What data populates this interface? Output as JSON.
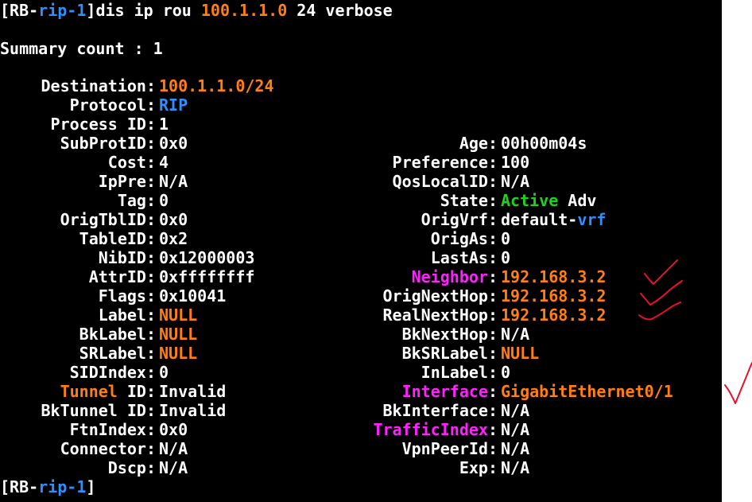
{
  "command": {
    "prompt_open": "[RB-",
    "prompt_name": "rip-1",
    "prompt_close": "]",
    "cmd": "dis ip rou ",
    "ip": "100.1.1.0",
    "rest": " 24 verbose"
  },
  "summary": {
    "label": "Summary count : ",
    "value": "1"
  },
  "destination": {
    "label": "Destination:",
    "value": "100.1.1.0/24"
  },
  "protocol": {
    "label": "Protocol:",
    "value": "RIP"
  },
  "process_id": {
    "label": "Process ID:",
    "value": "1"
  },
  "left_fields": [
    {
      "label": "SubProtID:",
      "value": "0x0"
    },
    {
      "label": "Cost:",
      "value": "4"
    },
    {
      "label": "IpPre:",
      "value": "N/A"
    },
    {
      "label": "Tag:",
      "value": "0"
    },
    {
      "label": "OrigTblID:",
      "value": "0x0"
    },
    {
      "label": "TableID:",
      "value": "0x2"
    },
    {
      "label": "NibID:",
      "value": "0x12000003"
    },
    {
      "label": "AttrID:",
      "value": "0xffffffff"
    },
    {
      "label": "Flags:",
      "value": "0x10041"
    },
    {
      "label": "Label:",
      "value": "NULL"
    },
    {
      "label": "BkLabel:",
      "value": "NULL"
    },
    {
      "label": "SRLabel:",
      "value": "NULL"
    },
    {
      "label": "SIDIndex:",
      "value": "0"
    },
    {
      "label": "Tunnel",
      "label2": " ID:",
      "value": "Invalid"
    },
    {
      "label": "BkTunnel ID:",
      "value": "Invalid"
    },
    {
      "label": "FtnIndex:",
      "value": "0x0"
    },
    {
      "label": "Connector:",
      "value": "N/A"
    },
    {
      "label": "Dscp:",
      "value": "N/A"
    }
  ],
  "right_fields": [
    {
      "label": "Age:",
      "value": "00h00m04s"
    },
    {
      "label": "Preference:",
      "value": "100"
    },
    {
      "label": "QosLocalID:",
      "value": "N/A"
    },
    {
      "label": "State:",
      "value": "Active",
      "value2": " Adv"
    },
    {
      "label": "OrigVrf:",
      "value": "default-",
      "value2": "vrf"
    },
    {
      "label": "OrigAs:",
      "value": "0"
    },
    {
      "label": "LastAs:",
      "value": "0"
    },
    {
      "label": "Neighbor",
      "label2": ":",
      "value": "192.168.3.2"
    },
    {
      "label": "OrigNextHop:",
      "value": "192.168.3.2"
    },
    {
      "label": "RealNextHop:",
      "value": "192.168.3.2"
    },
    {
      "label": "BkNextHop:",
      "value": "N/A"
    },
    {
      "label": "BkSRLabel:",
      "value": "NULL"
    },
    {
      "label": "InLabel:",
      "value": "0"
    },
    {
      "label": "Interface",
      "label2": ":",
      "value": "GigabitEthernet0/1"
    },
    {
      "label": "BkInterface:",
      "value": "N/A"
    },
    {
      "label": "TrafficIndex",
      "label2": ":",
      "value": "N/A"
    },
    {
      "label": "VpnPeerId:",
      "value": "N/A"
    },
    {
      "label": "Exp:",
      "value": "N/A"
    }
  ],
  "colors": {
    "background": "#000000",
    "text": "#ffffff",
    "orange": "#ff7f14",
    "blue": "#2f8fff",
    "green": "#1fd21f",
    "magenta": "#ff22ff",
    "annotation": "#e8102a"
  }
}
